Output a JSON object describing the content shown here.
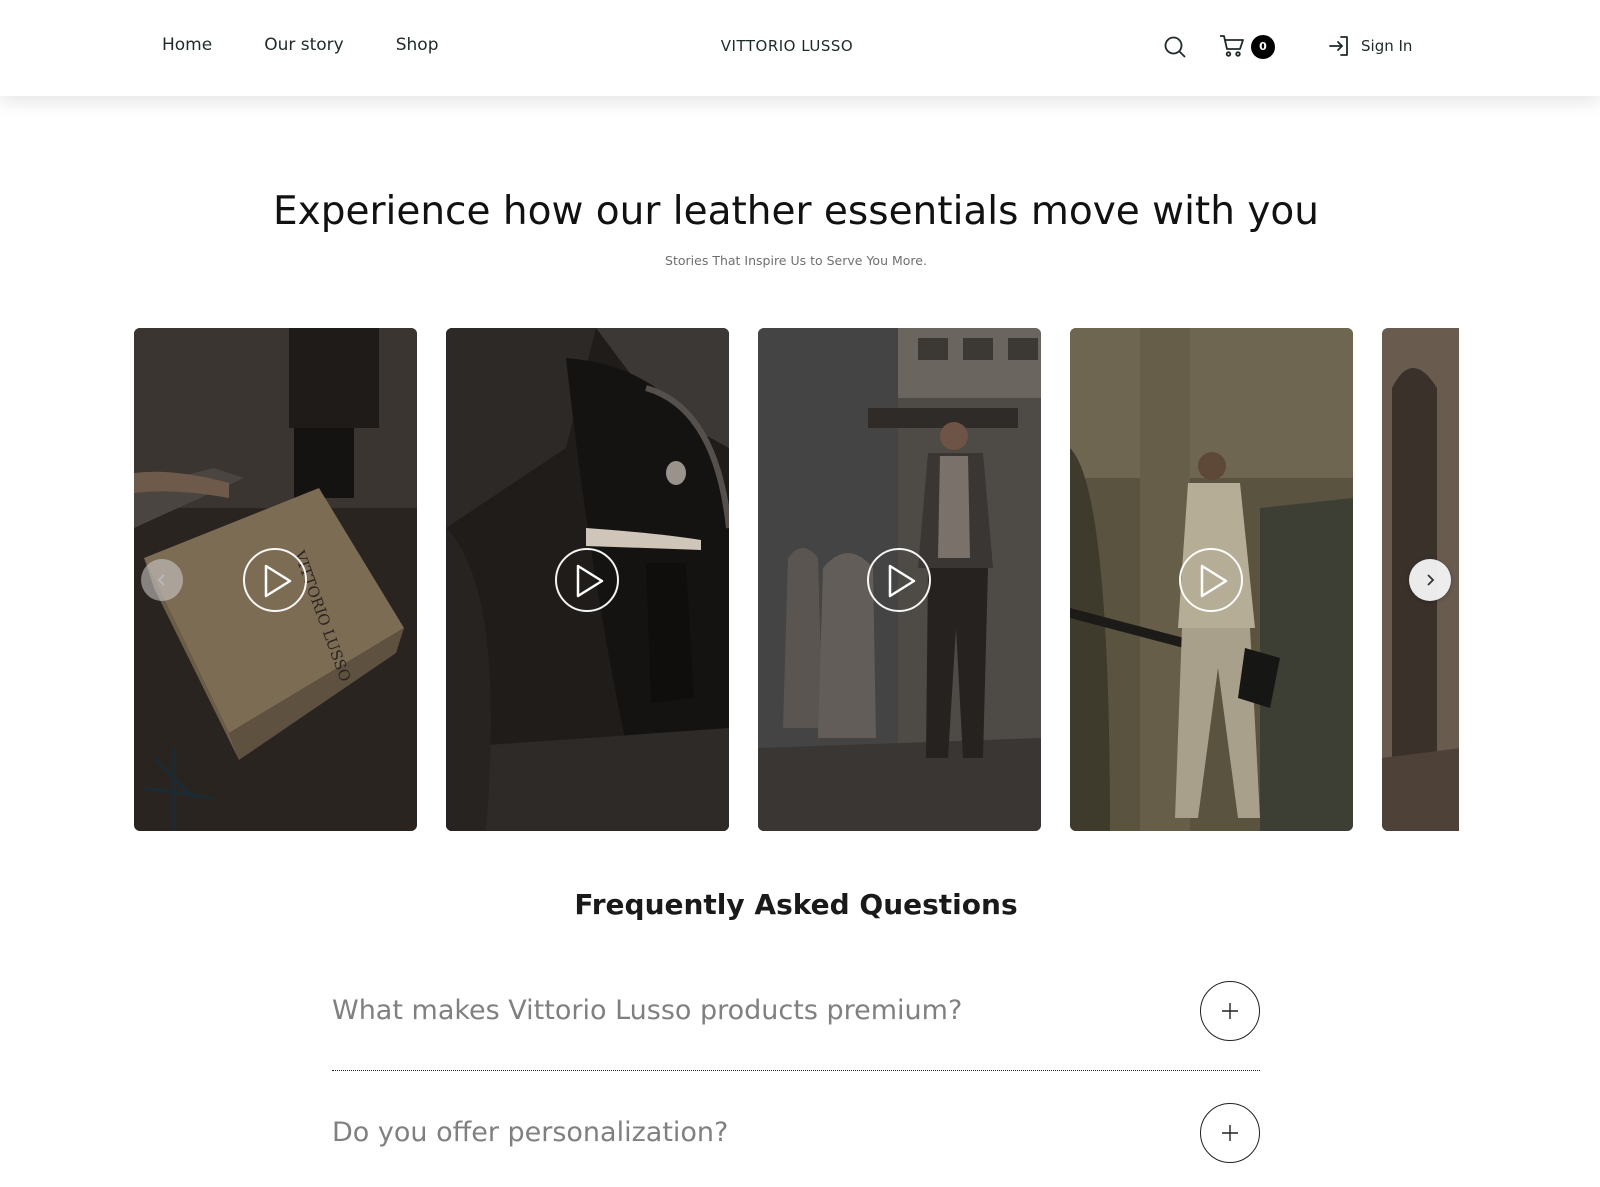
{
  "header": {
    "nav": [
      "Home",
      "Our story",
      "Shop"
    ],
    "logo": "VITTORIO LUSSO",
    "search_icon": "search-icon",
    "cart_icon": "cart-icon",
    "cart_count": "0",
    "signin_icon": "sign-in-icon",
    "signin_label": "Sign In"
  },
  "hero": {
    "title": "Experience how our leather essentials move with you",
    "subtitle": "Stories That Inspire Us to Serve You More."
  },
  "carousel": {
    "play_icon": "play-icon",
    "prev_icon": "chevron-left-icon",
    "next_icon": "chevron-right-icon",
    "cards": [
      {
        "scene": "gift box with VITTORIO LUSSO lettering",
        "box_text": "VITTORIO LUSSO"
      },
      {
        "scene": "hand holding leather bag by car door"
      },
      {
        "scene": "man in suit walking in courtyard"
      },
      {
        "scene": "man in beige suit walking with bag"
      },
      {
        "scene": "doorway interior"
      }
    ]
  },
  "faq": {
    "title": "Frequently Asked Questions",
    "items": [
      {
        "question": "What makes Vittorio Lusso products premium?",
        "icon": "plus-icon"
      },
      {
        "question": "Do you offer personalization?",
        "icon": "plus-icon"
      }
    ]
  },
  "colors": {
    "text": "#1e2a2a",
    "muted": "#808080",
    "badge": "#000000"
  }
}
